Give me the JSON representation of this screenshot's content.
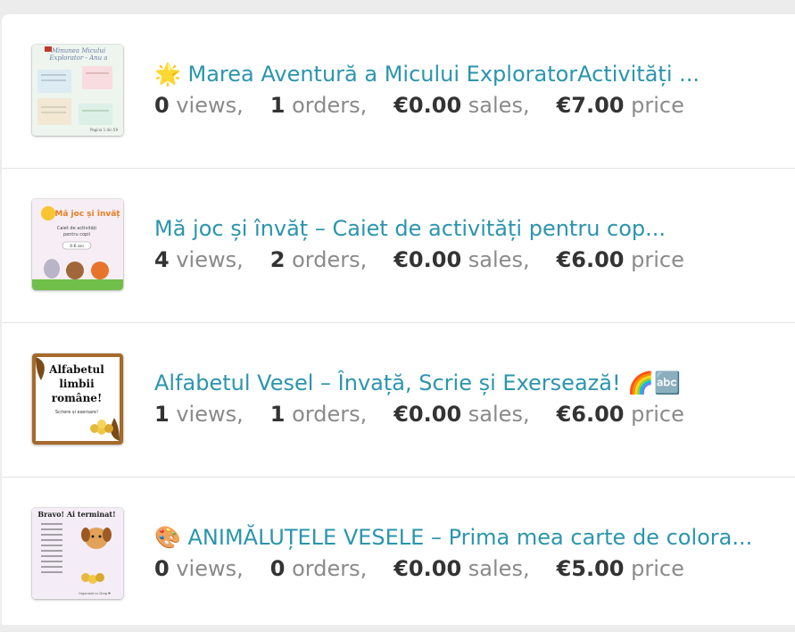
{
  "labels": {
    "views": "views,",
    "orders": "orders,",
    "sales": "sales,",
    "price": "price"
  },
  "products": [
    {
      "title": "🌟 Marea Aventură a Micului ExploratorActivități ...",
      "views": "0",
      "orders": "1",
      "sales": "€0.00",
      "price": "€7.00",
      "thumb_text": [
        "Minunea Micului",
        "Explorator - Anu a"
      ],
      "thumb_page": "Pagina 1 din 59"
    },
    {
      "title": "Mă joc și învăț – Caiet de activități pentru cop...",
      "views": "4",
      "orders": "2",
      "sales": "€0.00",
      "price": "€6.00",
      "thumb_text": [
        "Mă joc și învăț",
        "Caiet de activități",
        "pentru copii",
        "4-6 ani"
      ]
    },
    {
      "title": "Alfabetul Vesel – Învață, Scrie și Exersează! 🌈🔤",
      "views": "1",
      "orders": "1",
      "sales": "€0.00",
      "price": "€6.00",
      "thumb_text": [
        "Alfabetul",
        "limbii",
        "române!",
        "Scriere  și exersare!"
      ]
    },
    {
      "title": "🎨 ANIMĂLUȚELE VESELE – Prima mea carte de colora...",
      "views": "0",
      "orders": "0",
      "sales": "€0.00",
      "price": "€5.00",
      "thumb_text": [
        "Bravo! Ai terminat!",
        "Organizat cu Drag ❤"
      ]
    }
  ],
  "colors": {
    "title": "#2b95ad",
    "stat_value": "#333333",
    "stat_label": "#8a8a8a"
  }
}
